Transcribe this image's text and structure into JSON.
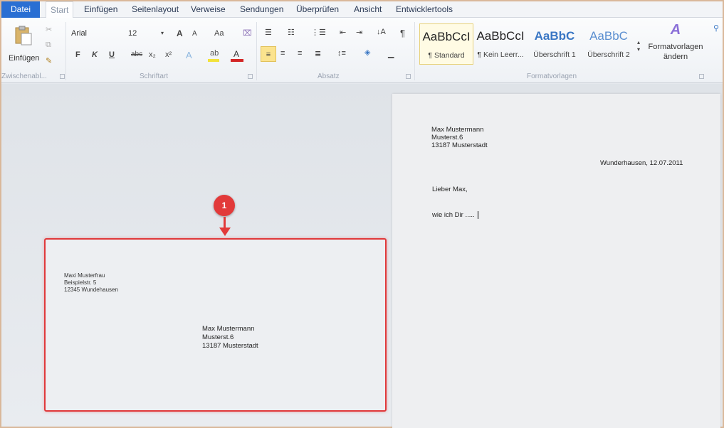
{
  "tabs": [
    "Datei",
    "Start",
    "Einfügen",
    "Seitenlayout",
    "Verweise",
    "Sendungen",
    "Überprüfen",
    "Ansicht",
    "Entwicklertools"
  ],
  "ribbon": {
    "clipboard": {
      "paste_label": "Einfügen",
      "group_label": "Zwischenabl..."
    },
    "font": {
      "font_name": "Arial",
      "font_size": "12",
      "bold": "F",
      "italic": "K",
      "underline": "U",
      "strikethrough": "abc",
      "subscript": "x₂",
      "superscript": "x²",
      "grow": "A",
      "shrink": "A",
      "case": "Aa",
      "group_label": "Schriftart"
    },
    "paragraph": {
      "pilcrow": "¶",
      "group_label": "Absatz"
    },
    "styles": {
      "items": [
        {
          "sample": "AaBbCcI",
          "name": "¶ Standard"
        },
        {
          "sample": "AaBbCcI",
          "name": "¶ Kein Leerr..."
        },
        {
          "sample": "AaBbC",
          "name": "Überschrift 1"
        },
        {
          "sample": "AaBbC",
          "name": "Überschrift 2"
        }
      ],
      "change_label_line1": "Formatvorlagen",
      "change_label_line2": "ändern",
      "group_label": "Formatvorlagen"
    },
    "icons": {
      "paste": "clipboard-icon",
      "bold": "bold-icon",
      "italic": "italic-icon",
      "underline": "underline-icon",
      "highlight": "highlighter-icon",
      "font_color": "font-color-icon",
      "bullets": "bullets-icon",
      "numbering": "numbering-icon",
      "align_left": "align-left-icon",
      "center": "align-center-icon",
      "align_right": "align-right-icon",
      "justify": "justify-icon",
      "sort": "sort-icon",
      "styles_change": "styles-change-icon"
    }
  },
  "envelope": {
    "sender": [
      "Maxi Musterfrau",
      "Beispielstr. 5",
      "12345  Wundehausen"
    ],
    "recipient": [
      "Max Mustermann",
      "Musterst.6",
      "13187 Musterstadt"
    ]
  },
  "annotation": {
    "number": "1"
  },
  "letter": {
    "sender": [
      "Max Mustermann",
      "Musterst.6",
      "13187 Musterstadt"
    ],
    "date_line": "Wunderhausen, 12.07.2011",
    "greeting": "Lieber Max,",
    "body": "wie ich Dir ....."
  },
  "colors": {
    "file_tab": "#2a6fd3",
    "highlight_border": "#e0393b",
    "badge": "#e23a3a",
    "heading_style": "#3a77c4",
    "font_color_bar": "#d32626",
    "highlight_color_bar": "#f2e23a"
  }
}
